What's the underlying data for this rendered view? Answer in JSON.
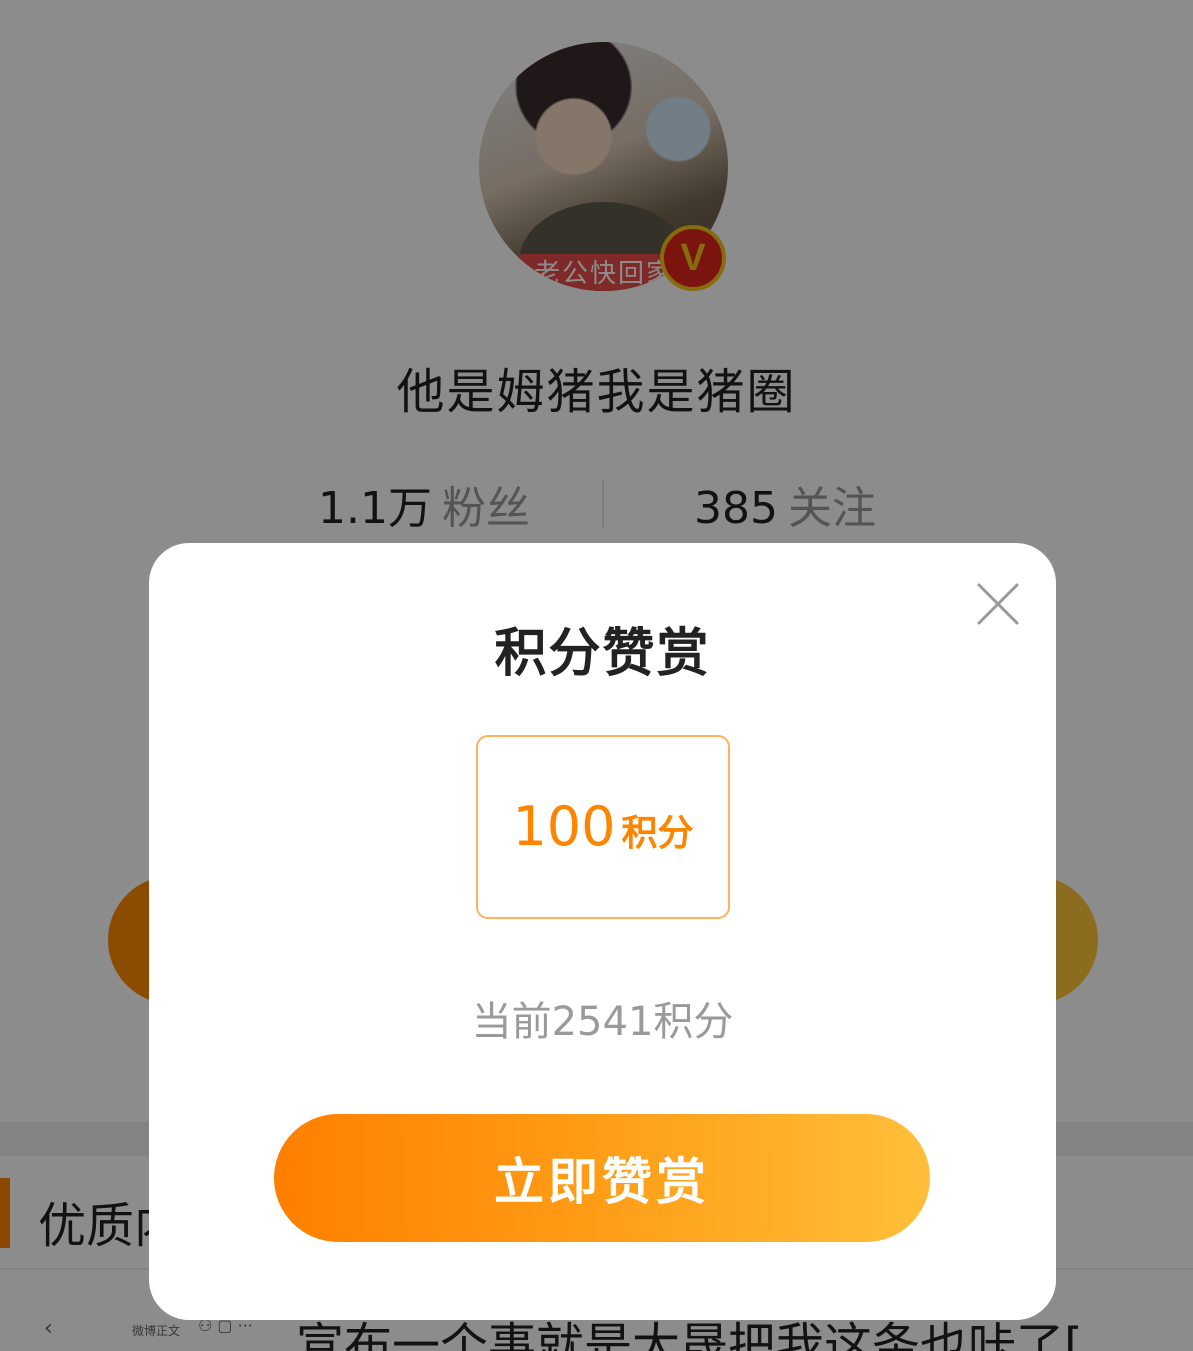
{
  "profile": {
    "avatar_banner_text": "老公快回家",
    "verified_badge": "V",
    "name": "他是姆猪我是猪圈",
    "fans_count": "1.1万",
    "fans_label": "粉丝",
    "following_count": "385",
    "following_label": "关注"
  },
  "section": {
    "title": "优质内容",
    "mini_back": "‹",
    "mini_title": "微博正文",
    "mini_icons": "⚇ ▢ ···",
    "post_preview": "宣布一个事就是大晟把我这条也咔了["
  },
  "modal": {
    "title": "积分赞赏",
    "close_icon": "close-icon",
    "amount_value": "100",
    "amount_unit": "积分",
    "balance_text": "当前2541积分",
    "submit_label": "立即赞赏"
  },
  "colors": {
    "accent": "#ff8400",
    "card_border": "#ffb15c",
    "button_gradient_start": "#ff7f00",
    "button_gradient_end": "#ffbf3a",
    "verified_red": "#e1261c",
    "verified_gold": "#f5c518"
  }
}
